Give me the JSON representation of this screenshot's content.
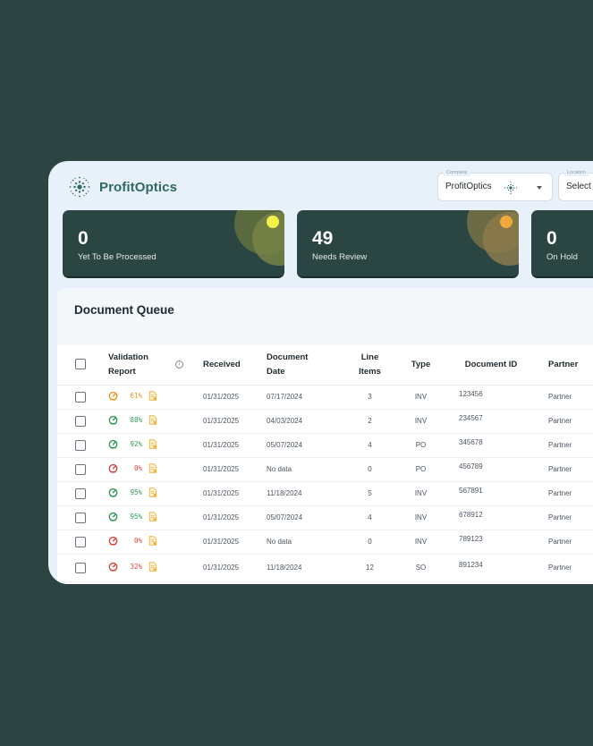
{
  "brand": {
    "name": "ProfitOptics"
  },
  "filters": {
    "company": {
      "label": "Company",
      "value": "ProfitOptics"
    },
    "location": {
      "label": "Location",
      "value": "Select"
    }
  },
  "stats": [
    {
      "value": "0",
      "label": "Yet To Be Processed",
      "accent": "#f2f24a"
    },
    {
      "value": "49",
      "label": "Needs Review",
      "accent": "#f2a93b"
    },
    {
      "value": "0",
      "label": "On Hold",
      "accent": ""
    }
  ],
  "queue": {
    "title": "Document Queue",
    "columns": {
      "validation": "Validation Report",
      "received": "Received",
      "doc_date": "Document Date",
      "line_items": "Line Items",
      "type": "Type",
      "doc_id": "Document ID",
      "partner": "Partner"
    },
    "rows": [
      {
        "pct": "61%",
        "status": "warn",
        "received": "01/31/2025",
        "doc_date": "07/17/2024",
        "line_items": "3",
        "type": "INV",
        "doc_id": "123456",
        "partner": "Partner"
      },
      {
        "pct": "88%",
        "status": "good",
        "received": "01/31/2025",
        "doc_date": "04/03/2024",
        "line_items": "2",
        "type": "INV",
        "doc_id": "234567",
        "partner": "Partner"
      },
      {
        "pct": "92%",
        "status": "good",
        "received": "01/31/2025",
        "doc_date": "05/07/2024",
        "line_items": "4",
        "type": "PO",
        "doc_id": "345678",
        "partner": "Partner"
      },
      {
        "pct": "0%",
        "status": "bad",
        "received": "01/31/2025",
        "doc_date": "No data",
        "line_items": "0",
        "type": "PO",
        "doc_id": "456789",
        "partner": "Partner"
      },
      {
        "pct": "95%",
        "status": "good",
        "received": "01/31/2025",
        "doc_date": "11/18/2024",
        "line_items": "5",
        "type": "INV",
        "doc_id": "567891",
        "partner": "Partner"
      },
      {
        "pct": "95%",
        "status": "good",
        "received": "01/31/2025",
        "doc_date": "05/07/2024",
        "line_items": "4",
        "type": "INV",
        "doc_id": "678912",
        "partner": "Partner"
      },
      {
        "pct": "0%",
        "status": "bad",
        "received": "01/31/2025",
        "doc_date": "No data",
        "line_items": "0",
        "type": "INV",
        "doc_id": "789123",
        "partner": "Partner"
      },
      {
        "pct": "32%",
        "status": "bad",
        "received": "01/31/2025",
        "doc_date": "11/18/2024",
        "line_items": "12",
        "type": "SO",
        "doc_id": "891234",
        "partner": "Partner"
      }
    ]
  },
  "status_colors": {
    "good": "#2e9a58",
    "warn": "#f0961e",
    "bad": "#d8443b",
    "doc_icon": "#f3b43c"
  }
}
